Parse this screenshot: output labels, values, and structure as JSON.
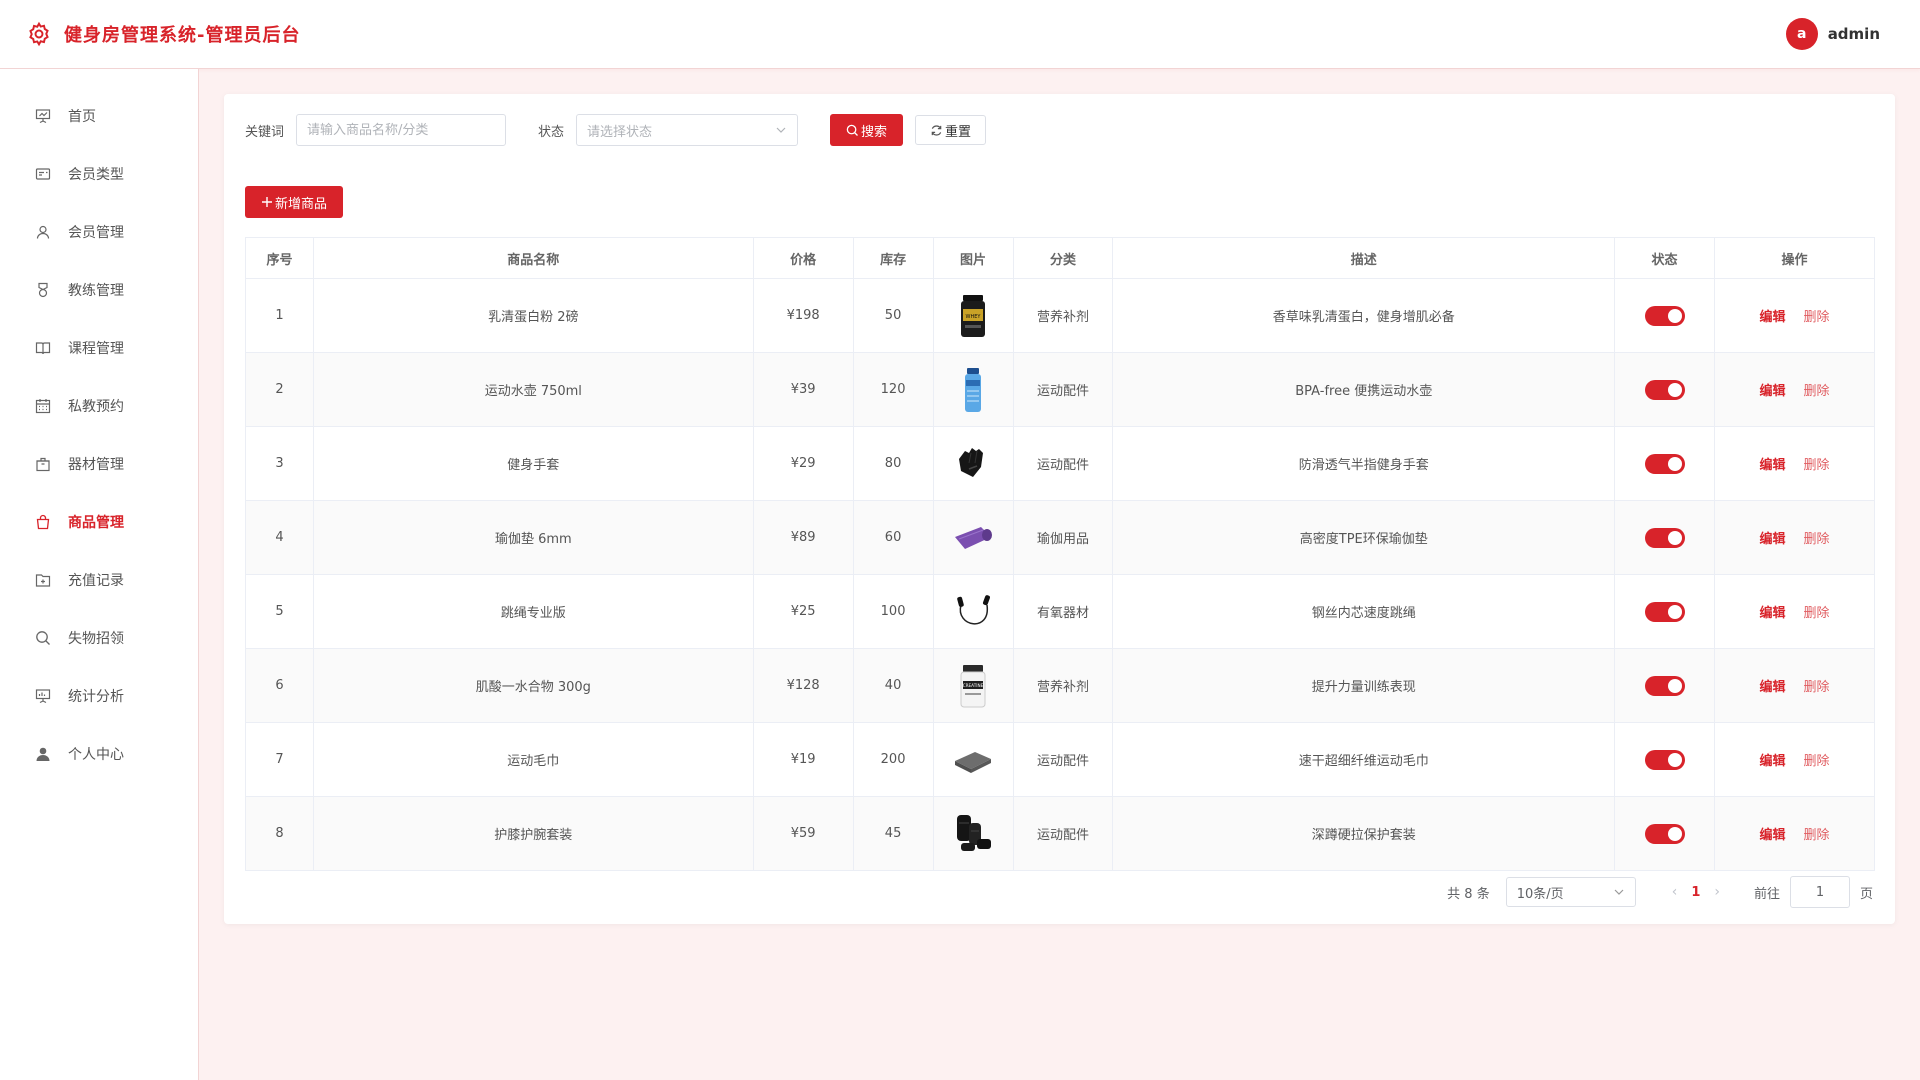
{
  "header": {
    "title": "健身房管理系统-管理员后台",
    "avatar_letter": "a",
    "username": "admin",
    "brand_color": "#d8232a"
  },
  "sidebar": {
    "items": [
      {
        "label": "首页",
        "icon": "presentation-chart-icon"
      },
      {
        "label": "会员类型",
        "icon": "id-card-icon"
      },
      {
        "label": "会员管理",
        "icon": "user-icon"
      },
      {
        "label": "教练管理",
        "icon": "medal-icon"
      },
      {
        "label": "课程管理",
        "icon": "book-icon"
      },
      {
        "label": "私教预约",
        "icon": "calendar-icon"
      },
      {
        "label": "器材管理",
        "icon": "box-icon"
      },
      {
        "label": "商品管理",
        "icon": "shopping-bag-icon",
        "active": true
      },
      {
        "label": "充值记录",
        "icon": "folder-icon"
      },
      {
        "label": "失物招领",
        "icon": "search-icon"
      },
      {
        "label": "统计分析",
        "icon": "data-board-icon"
      },
      {
        "label": "个人中心",
        "icon": "user-filled-icon"
      }
    ]
  },
  "filters": {
    "keyword_label": "关键词",
    "keyword_placeholder": "请输入商品名称/分类",
    "status_label": "状态",
    "status_placeholder": "请选择状态",
    "search_label": "搜索",
    "reset_label": "重置"
  },
  "add_label": "新增商品",
  "table": {
    "headers": [
      "序号",
      "商品名称",
      "价格",
      "库存",
      "图片",
      "分类",
      "描述",
      "状态",
      "操作"
    ],
    "edit_label": "编辑",
    "delete_label": "删除",
    "rows": [
      {
        "id": "1",
        "name": "乳清蛋白粉 2磅",
        "price": "¥198",
        "stock": "50",
        "category": "营养补剂",
        "desc": "香草味乳清蛋白，健身增肌必备",
        "image": "protein-jar",
        "enabled": true
      },
      {
        "id": "2",
        "name": "运动水壶 750ml",
        "price": "¥39",
        "stock": "120",
        "category": "运动配件",
        "desc": "BPA-free 便携运动水壶",
        "image": "water-bottle",
        "enabled": true
      },
      {
        "id": "3",
        "name": "健身手套",
        "price": "¥29",
        "stock": "80",
        "category": "运动配件",
        "desc": "防滑透气半指健身手套",
        "image": "gloves",
        "enabled": true
      },
      {
        "id": "4",
        "name": "瑜伽垫 6mm",
        "price": "¥89",
        "stock": "60",
        "category": "瑜伽用品",
        "desc": "高密度TPE环保瑜伽垫",
        "image": "yoga-mat",
        "enabled": true
      },
      {
        "id": "5",
        "name": "跳绳专业版",
        "price": "¥25",
        "stock": "100",
        "category": "有氧器材",
        "desc": "钢丝内芯速度跳绳",
        "image": "jump-rope",
        "enabled": true
      },
      {
        "id": "6",
        "name": "肌酸一水合物 300g",
        "price": "¥128",
        "stock": "40",
        "category": "营养补剂",
        "desc": "提升力量训练表现",
        "image": "creatine-jar",
        "enabled": true
      },
      {
        "id": "7",
        "name": "运动毛巾",
        "price": "¥19",
        "stock": "200",
        "category": "运动配件",
        "desc": "速干超细纤维运动毛巾",
        "image": "towel",
        "enabled": true
      },
      {
        "id": "8",
        "name": "护膝护腕套装",
        "price": "¥59",
        "stock": "45",
        "category": "运动配件",
        "desc": "深蹲硬拉保护套装",
        "image": "knee-wrist-set",
        "enabled": true
      }
    ]
  },
  "pagination": {
    "total_text": "共 8 条",
    "page_size": "10条/页",
    "current_page": "1",
    "goto_label": "前往",
    "goto_value": "1",
    "page_unit": "页"
  }
}
